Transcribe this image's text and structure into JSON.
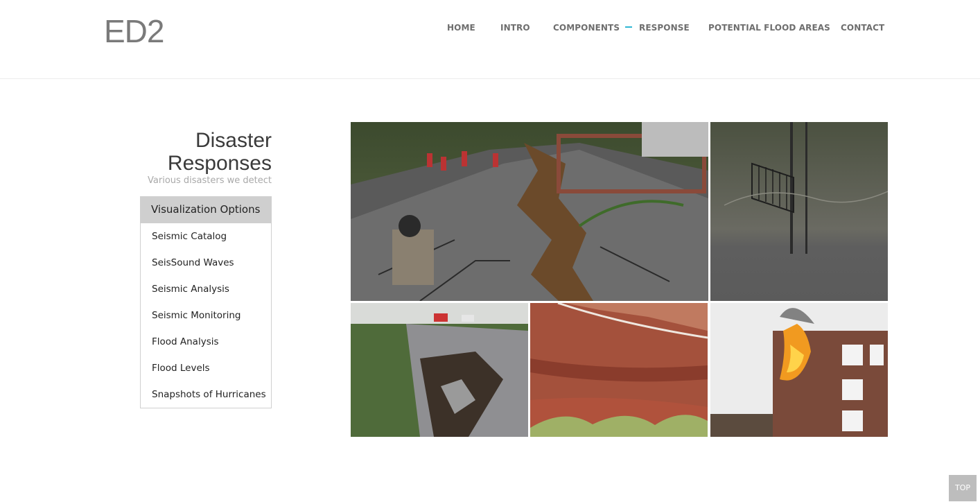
{
  "logo": "ED2",
  "nav": {
    "items": [
      {
        "label": "HOME"
      },
      {
        "label": "INTRO"
      },
      {
        "label": "COMPONENTS"
      },
      {
        "label": "RESPONSE"
      },
      {
        "label": "POTENTIAL FLOOD AREAS"
      },
      {
        "label": "CONTACT"
      }
    ],
    "accent_color": "#2fb6d4"
  },
  "sidebar": {
    "title": "Disaster Responses",
    "subtitle": "Various disasters we detect",
    "menu_header": "Visualization Options",
    "items": [
      {
        "label": "Seismic Catalog"
      },
      {
        "label": "SeisSound Waves"
      },
      {
        "label": "Seismic Analysis"
      },
      {
        "label": "Seismic Monitoring"
      },
      {
        "label": "Flood Analysis"
      },
      {
        "label": "Flood Levels"
      },
      {
        "label": "Snapshots of Hurricanes"
      }
    ]
  },
  "gallery": [
    {
      "name": "cracked-road-photo"
    },
    {
      "name": "flooded-fence-photo"
    },
    {
      "name": "collapsed-road-photo"
    },
    {
      "name": "red-rock-cliff-photo"
    },
    {
      "name": "burning-building-photo"
    }
  ],
  "top_button": "TOP"
}
